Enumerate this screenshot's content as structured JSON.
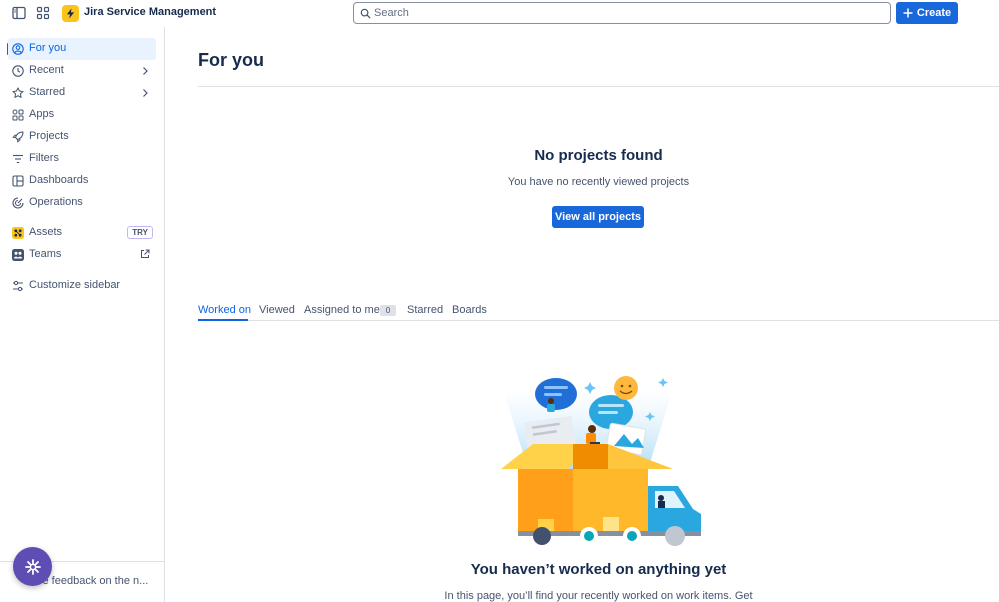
{
  "topbar": {
    "app_title": "Jira Service Management",
    "search_placeholder": "Search",
    "create_label": "Create"
  },
  "sidebar": {
    "items": [
      {
        "label": "For you",
        "icon": "person-circle-icon",
        "active": true
      },
      {
        "label": "Recent",
        "icon": "clock-icon"
      },
      {
        "label": "Starred",
        "icon": "star-icon"
      },
      {
        "label": "Apps",
        "icon": "apps-icon"
      },
      {
        "label": "Projects",
        "icon": "rocket-icon"
      },
      {
        "label": "Filters",
        "icon": "filter-icon"
      },
      {
        "label": "Dashboards",
        "icon": "dashboard-icon"
      },
      {
        "label": "Operations",
        "icon": "operations-icon"
      },
      {
        "label": "Assets",
        "icon": "assets-icon",
        "badge": "TRY"
      },
      {
        "label": "Teams",
        "icon": "teams-icon"
      },
      {
        "label": "Customize sidebar",
        "icon": "sliders-icon"
      }
    ],
    "feedback_label": "Give feedback on the n..."
  },
  "main": {
    "title": "For you",
    "no_projects_title": "No projects found",
    "no_projects_sub": "You have no recently viewed projects",
    "view_all_label": "View all projects",
    "tabs": [
      {
        "label": "Worked on",
        "active": true
      },
      {
        "label": "Viewed"
      },
      {
        "label": "Assigned to me",
        "count": "0"
      },
      {
        "label": "Starred"
      },
      {
        "label": "Boards"
      }
    ],
    "empty_title": "You haven’t worked on anything yet",
    "empty_sub": "In this page, you’ll find your recently worked on work items. Get"
  },
  "colors": {
    "brand_blue": "#1868db",
    "active_bg": "#e9f2ff",
    "logo_yellow": "#fcc41b",
    "fab_purple": "#5e4db2"
  }
}
